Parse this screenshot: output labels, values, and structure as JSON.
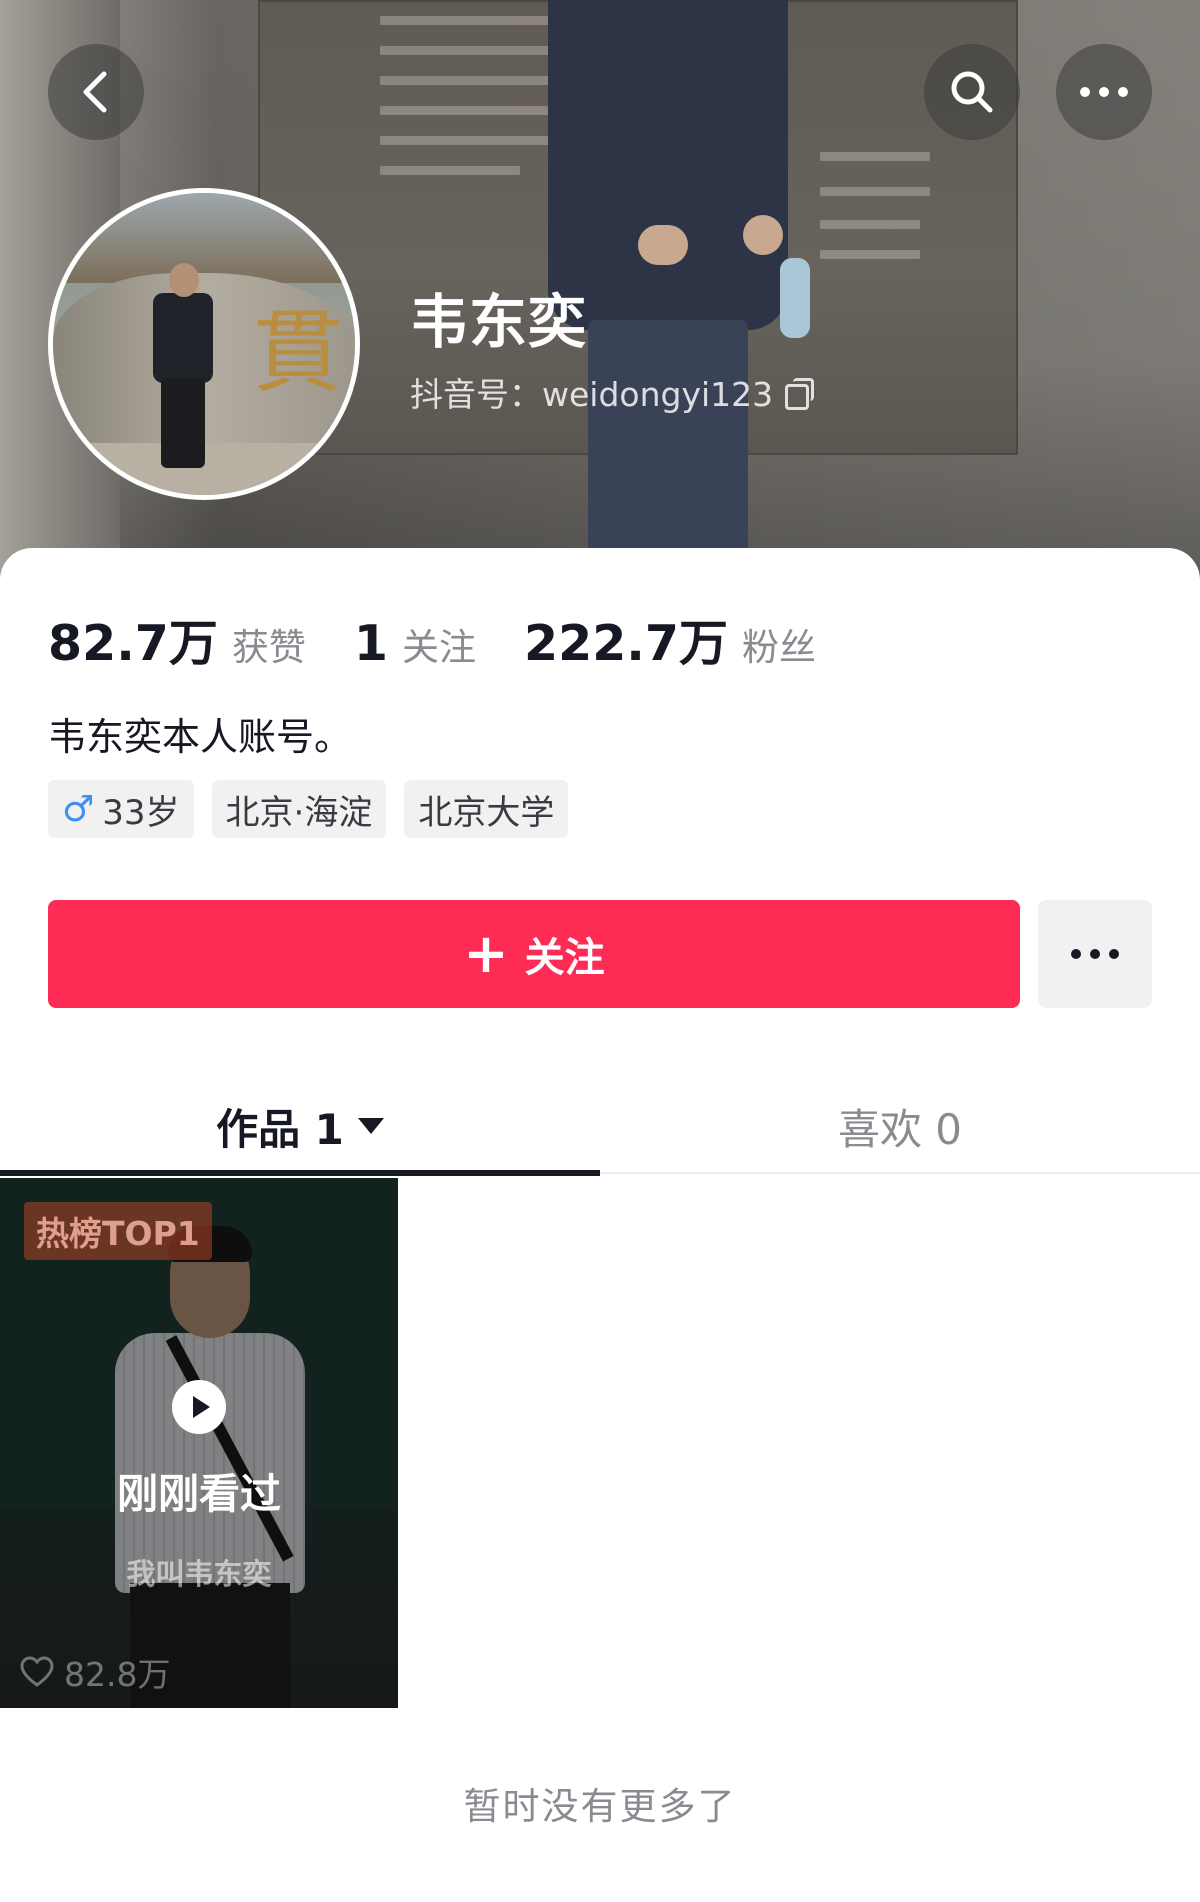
{
  "header": {
    "name": "韦东奕",
    "douyin_id": "抖音号：weidongyi123",
    "icons": {
      "back": "back-arrow-icon",
      "search": "search-icon",
      "more": "more-dots-icon",
      "copy": "copy-icon"
    }
  },
  "stats": [
    {
      "num": "82.7万",
      "label": "获赞"
    },
    {
      "num": "1",
      "label": "关注"
    },
    {
      "num": "222.7万",
      "label": "粉丝"
    }
  ],
  "bio": "韦东奕本人账号。",
  "tags": {
    "age": "33岁",
    "location": "北京·海淀",
    "school": "北京大学"
  },
  "actions": {
    "follow_plus": "+",
    "follow_label": "关注"
  },
  "tabs": {
    "works": "作品 1",
    "likes": "喜欢 0"
  },
  "video": {
    "badge": "热榜TOP1",
    "status": "刚刚看过",
    "caption": "我叫韦东奕",
    "likes": "82.8万"
  },
  "footer": "暂时没有更多了",
  "colors": {
    "accent": "#fe2c55",
    "text": "#161823",
    "muted": "#8a8b91"
  }
}
